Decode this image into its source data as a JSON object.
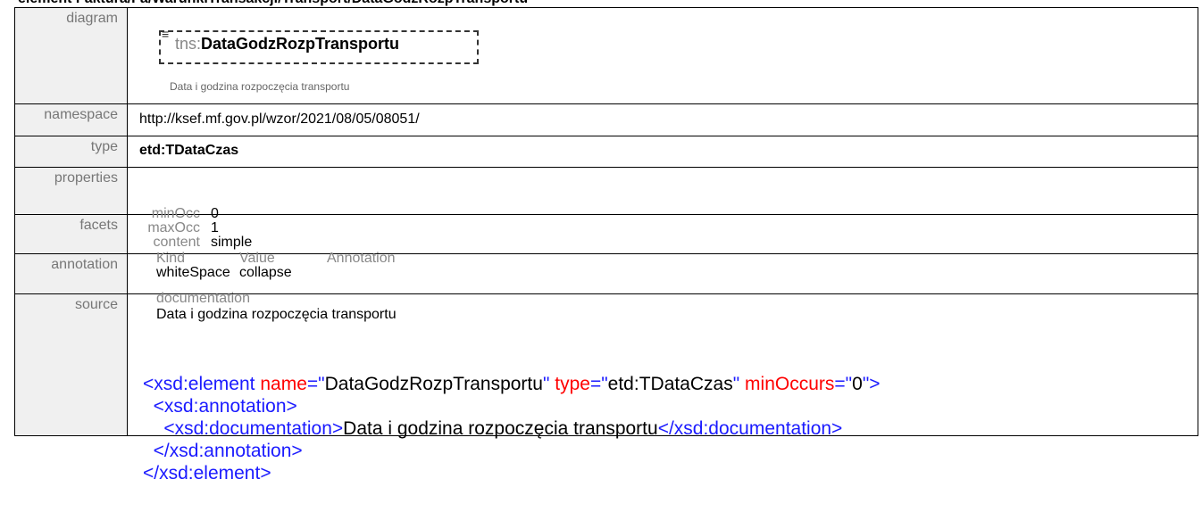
{
  "heading": "element Faktura/Fa/WarunkiTransakcji/Transport/DataGodzRozpTransportu",
  "labels": {
    "diagram": "diagram",
    "namespace": "namespace",
    "type": "type",
    "properties": "properties",
    "facets": "facets",
    "annotation": "annotation",
    "source": "source"
  },
  "diagram": {
    "prefix": "tns:",
    "name": "DataGodzRozpTransportu",
    "doc": "Data i godzina rozpoczęcia transportu"
  },
  "namespace": "http://ksef.mf.gov.pl/wzor/2021/08/05/08051/",
  "type": "etd:TDataCzas",
  "properties": [
    {
      "key": "minOcc",
      "value": "0"
    },
    {
      "key": "maxOcc",
      "value": "1"
    },
    {
      "key": "content",
      "value": "simple"
    }
  ],
  "facets": {
    "headers": [
      "Kind",
      "Value",
      "Annotation"
    ],
    "rows": [
      {
        "kind": "whiteSpace",
        "value": "collapse",
        "annotation": ""
      }
    ]
  },
  "annotation": {
    "key": "documentation",
    "value": "Data i godzina rozpoczęcia transportu"
  },
  "source": {
    "l1_open": "<xsd:element",
    "l1_attr1": "name",
    "l1_val1": "DataGodzRozpTransportu",
    "l1_attr2": "type",
    "l1_val2": "etd:TDataCzas",
    "l1_attr3": "minOccurs",
    "l1_val3": "0",
    "l2": "<xsd:annotation>",
    "l3_open": "<xsd:documentation>",
    "l3_text": "Data i godzina rozpoczęcia transportu",
    "l3_close": "</xsd:documentation>",
    "l4": "</xsd:annotation>",
    "l5": "</xsd:element>"
  }
}
